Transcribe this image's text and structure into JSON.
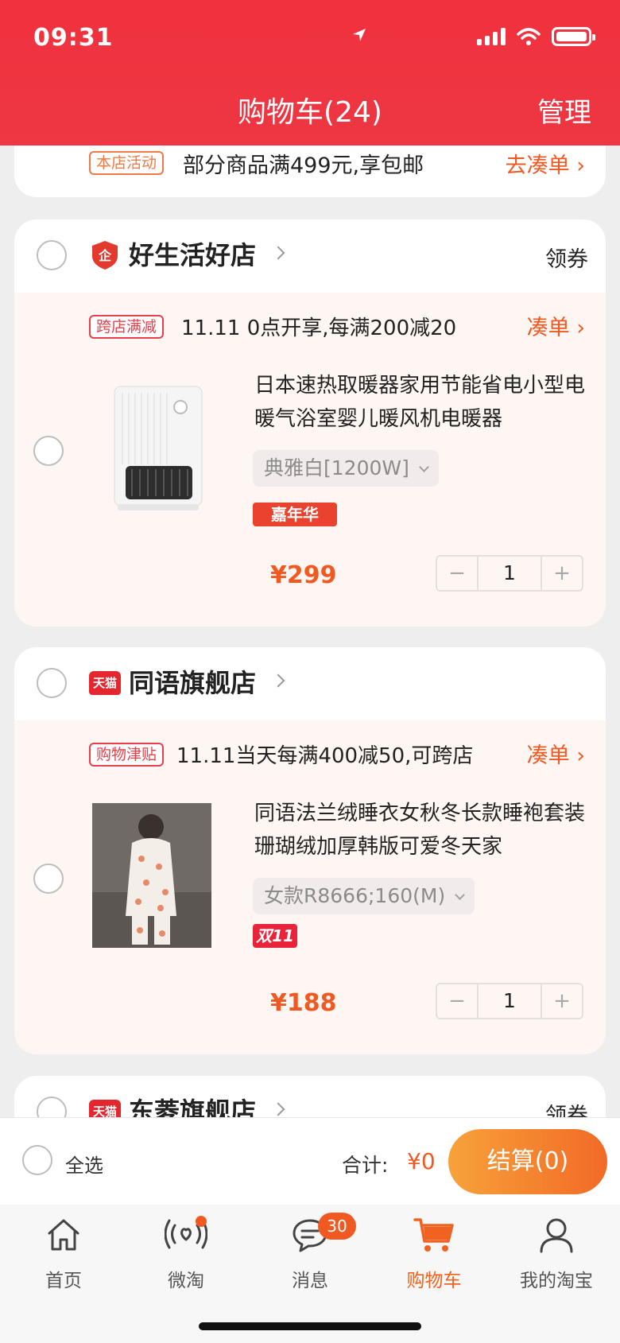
{
  "status_bar": {
    "time": "09:31"
  },
  "header": {
    "title": "购物车(24)",
    "manage_label": "管理"
  },
  "promo": {
    "tag": "本店活动",
    "text": "部分商品满499元,享包邮",
    "link": "去凑单 ›"
  },
  "stores": [
    {
      "name": "好生活好店",
      "coupon_label": "领券",
      "discount": {
        "tag": "跨店满减",
        "text": "11.11 0点开享,每满200减20",
        "link": "凑单 ›"
      },
      "item": {
        "title": "日本速热取暖器家用节能省电小型电暖气浴室婴儿暖风机电暖器",
        "sku": "典雅白[1200W]",
        "badge": "嘉年华",
        "price": "¥299",
        "quantity": "1"
      }
    },
    {
      "name": "同语旗舰店",
      "logo_text": "天猫",
      "discount": {
        "tag": "购物津贴",
        "text": "11.11当天每满400减50,可跨店",
        "link": "凑单 ›"
      },
      "item": {
        "title": "同语法兰绒睡衣女秋冬长款睡袍套装珊瑚绒加厚韩版可爱冬天家",
        "sku": "女款R8666;160(M)",
        "badge": "双11",
        "price": "¥188",
        "quantity": "1"
      }
    },
    {
      "name": "东菱旗舰店",
      "logo_text": "天猫",
      "coupon_label": "领券"
    }
  ],
  "stepper": {
    "minus": "−",
    "plus": "+"
  },
  "checkout": {
    "select_all": "全选",
    "total_label": "合计:",
    "total_value": "¥0",
    "button": "结算(0)"
  },
  "tabs": [
    {
      "label": "首页",
      "icon": "home-icon"
    },
    {
      "label": "微淘",
      "icon": "broadcast-icon"
    },
    {
      "label": "消息",
      "icon": "message-icon",
      "badge": "30"
    },
    {
      "label": "购物车",
      "icon": "cart-icon",
      "active": true
    },
    {
      "label": "我的淘宝",
      "icon": "profile-icon"
    }
  ],
  "colors": {
    "brand_red": "#ee3743",
    "accent_orange": "#f05a22"
  }
}
